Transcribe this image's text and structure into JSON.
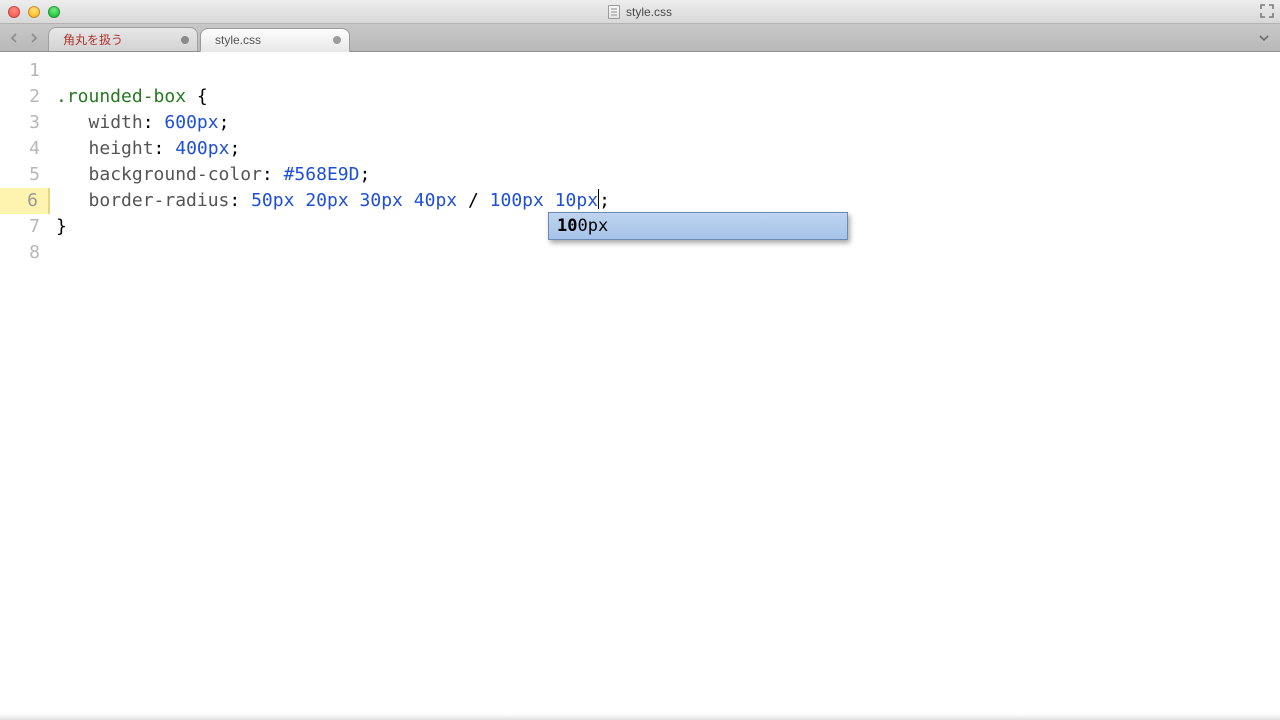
{
  "window": {
    "title": "style.css"
  },
  "tabs": [
    {
      "label": "角丸を扱う",
      "active": false,
      "dirty": true
    },
    {
      "label": "style.css",
      "active": true,
      "dirty": true
    }
  ],
  "gutter": {
    "lines": [
      "1",
      "2",
      "3",
      "4",
      "5",
      "6",
      "7",
      "8"
    ],
    "current_index": 5
  },
  "code": {
    "l1": "",
    "l2_selector": ".rounded-box",
    "l2_brace": " {",
    "l3_prop": "width",
    "l3_num": "600",
    "l3_unit": "px",
    "l4_prop": "height",
    "l4_num": "400",
    "l4_unit": "px",
    "l5_prop": "background-color",
    "l5_val": "#568E9D",
    "l6_prop": "border-radius",
    "l6_v1n": "50",
    "l6_v1u": "px",
    "l6_v2n": "20",
    "l6_v2u": "px",
    "l6_v3n": "30",
    "l6_v3u": "px",
    "l6_v4n": "40",
    "l6_v4u": "px",
    "l6_v5n": "100",
    "l6_v5u": "px",
    "l6_v6n": "10",
    "l6_v6u": "px",
    "l7_brace": "}",
    "colon": ":",
    "semicolon": ";",
    "space": " ",
    "slash": "/",
    "indent": "   "
  },
  "autocomplete": {
    "prefix": "10",
    "match": "0",
    "suffix": "px"
  }
}
